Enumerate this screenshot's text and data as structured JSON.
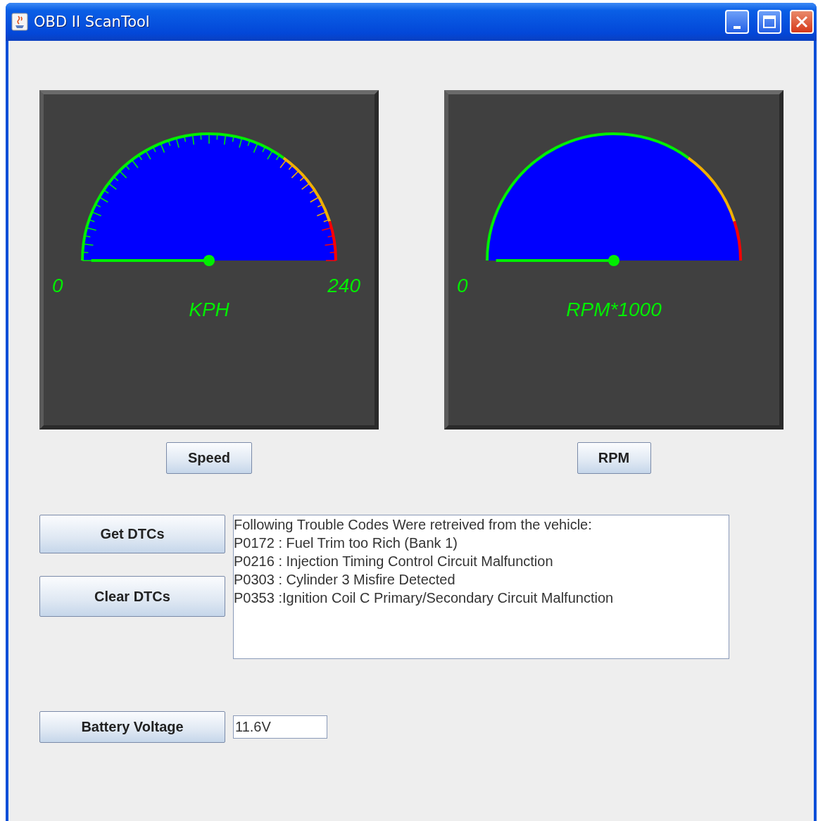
{
  "window": {
    "title": "OBD II ScanTool"
  },
  "gauges": [
    {
      "min_label": "0",
      "max_label": "240",
      "unit": "KPH",
      "ticks": true,
      "button": "Speed"
    },
    {
      "min_label": "0",
      "unit": "RPM*1000",
      "ticks": false,
      "button": "RPM"
    }
  ],
  "dtc_buttons": [
    "Get DTCs",
    "Clear DTCs"
  ],
  "dtc_output": [
    "Following Trouble Codes Were retreived from the vehicle:",
    "P0172 : Fuel Trim too Rich (Bank 1)",
    "P0216 : Injection Timing Control Circuit Malfunction",
    "P0303 : Cylinder 3 Misfire Detected",
    "P0353 :Ignition Coil C Primary/Secondary Circuit Malfunction"
  ],
  "battery": {
    "button": "Battery Voltage",
    "value": "11.6V"
  }
}
